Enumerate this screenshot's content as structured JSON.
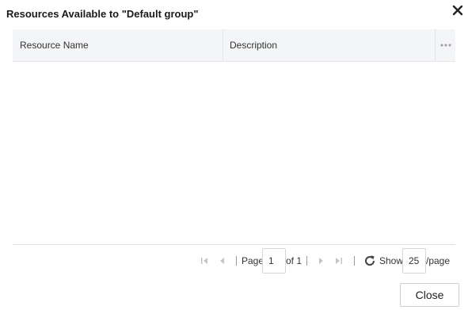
{
  "dialog": {
    "title": "Resources Available to \"Default group\"",
    "close_icon": "close-icon"
  },
  "grid": {
    "columns": [
      "Resource Name",
      "Description"
    ],
    "column_menu_icon": "more-horizontal-icon",
    "rows": []
  },
  "pager": {
    "page_label": "Page",
    "page_value": "1",
    "of_label": "of 1",
    "show_label": "Show",
    "page_size_value": "25",
    "per_page_label": "/page",
    "icons": [
      "first-page-icon",
      "prev-page-icon",
      "next-page-icon",
      "last-page-icon",
      "refresh-icon"
    ]
  },
  "footer": {
    "close_label": "Close"
  },
  "colors": {
    "header_bg": "#f4f5f7",
    "disabled_icon": "#c4c4c4"
  }
}
